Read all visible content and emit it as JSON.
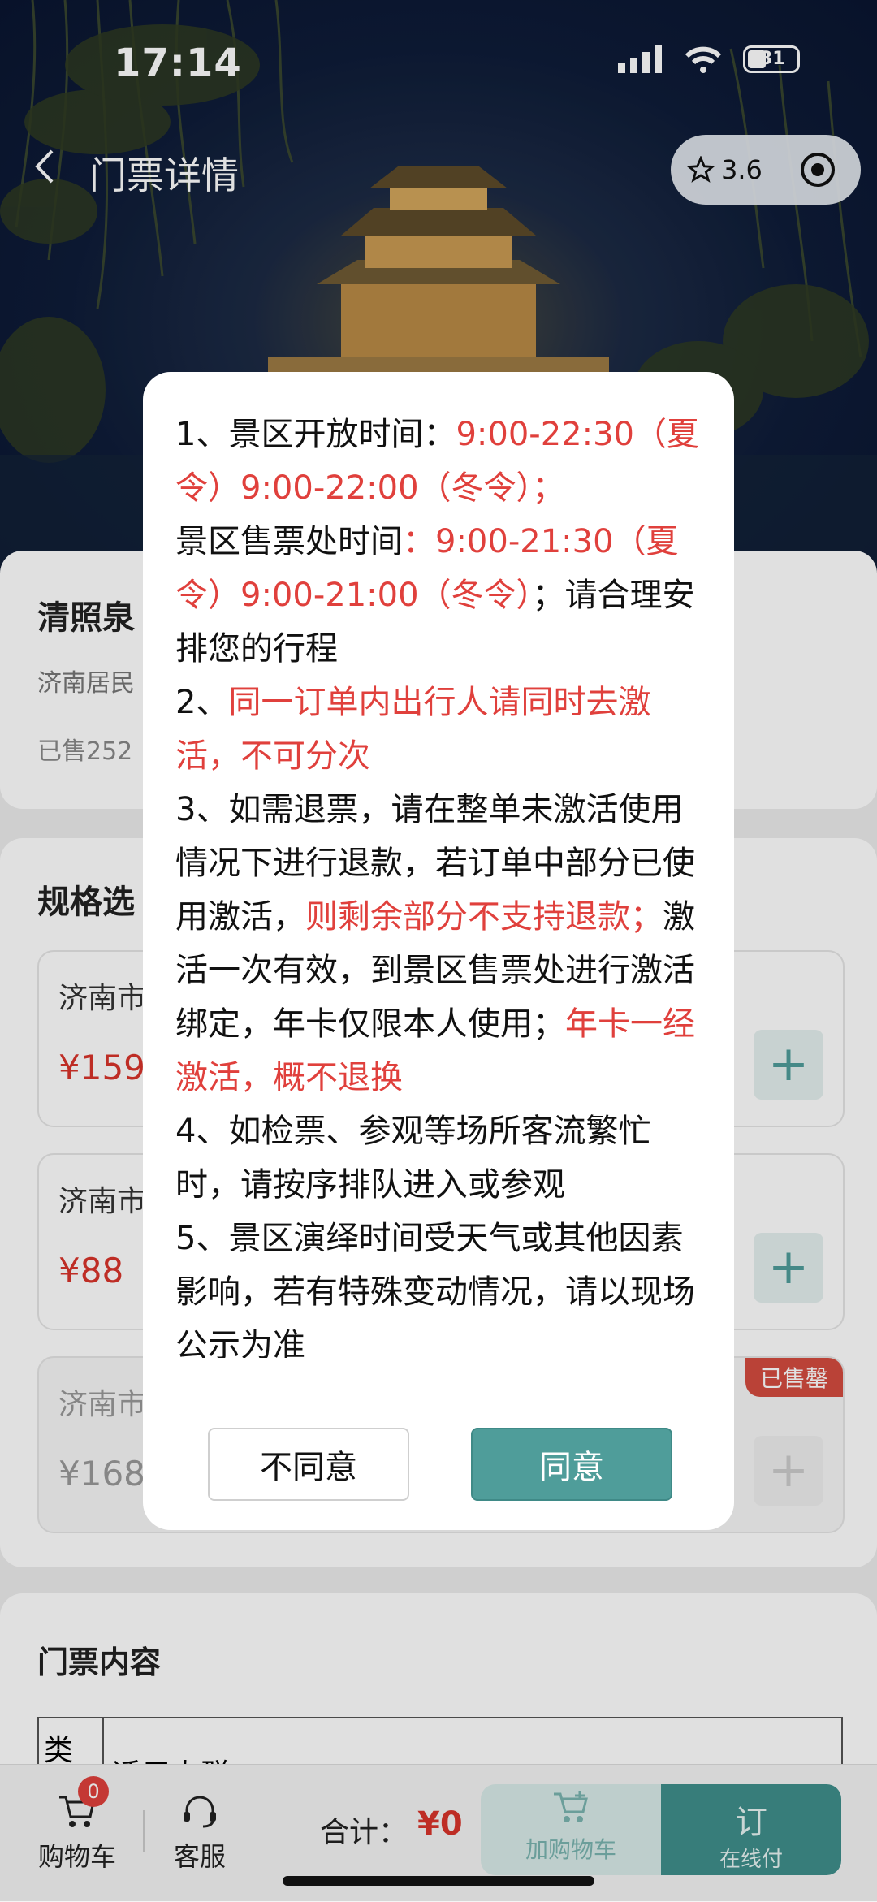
{
  "status_bar": {
    "time": "17:14",
    "battery": "31"
  },
  "nav": {
    "title": "门票详情",
    "rating": "3.6"
  },
  "product": {
    "name": "清照泉",
    "subtitle": "济南居民",
    "sold": "已售252"
  },
  "spec": {
    "section_title": "规格选",
    "items": [
      {
        "name": "济南市",
        "price": "¥159",
        "soldout": ""
      },
      {
        "name": "济南市",
        "price": "¥88",
        "soldout": ""
      },
      {
        "name": "济南市",
        "price": "¥168",
        "soldout": "已售罄"
      }
    ]
  },
  "content": {
    "title": "门票内容",
    "col1": "类",
    "col2": "适用人群"
  },
  "dialog": {
    "p1_a": "1、景区开放时间：",
    "p1_b": "9:00-22:30（夏令）9:00-22:00（冬令）；",
    "p1_c": "景区售票处时间",
    "p1_d": "：9:00-21:30（夏令）9:00-21:00（冬令）",
    "p1_e": "；请合理安排您的行程",
    "p2_a": "2、",
    "p2_b": "同一订单内出行人请同时去激活，不可分次",
    "p3_a": "3、如需退票，请在整单未激活使用情况下进行退款，若订单中部分已使用激活，",
    "p3_b": "则剩余部分不支持退款；",
    "p3_c": "激活一次有效，到景区售票处进行激活绑定，年卡仅限本人使用；",
    "p3_d": "年卡一经激活，概不退换",
    "p4": "4、如检票、参观等场所客流繁忙时，请按序排队进入或参观",
    "p5": "5、景区演绎时间受天气或其他因素影响，若有特殊变动情况，请以现场公示为准",
    "disagree": "不同意",
    "agree": "同意"
  },
  "bottom": {
    "cart": "购物车",
    "cart_count": "0",
    "service": "客服",
    "total_label": "合计：",
    "total_value": "¥0",
    "add_cart": "加购物车",
    "order_main": "订",
    "order_sub": "在线付"
  }
}
